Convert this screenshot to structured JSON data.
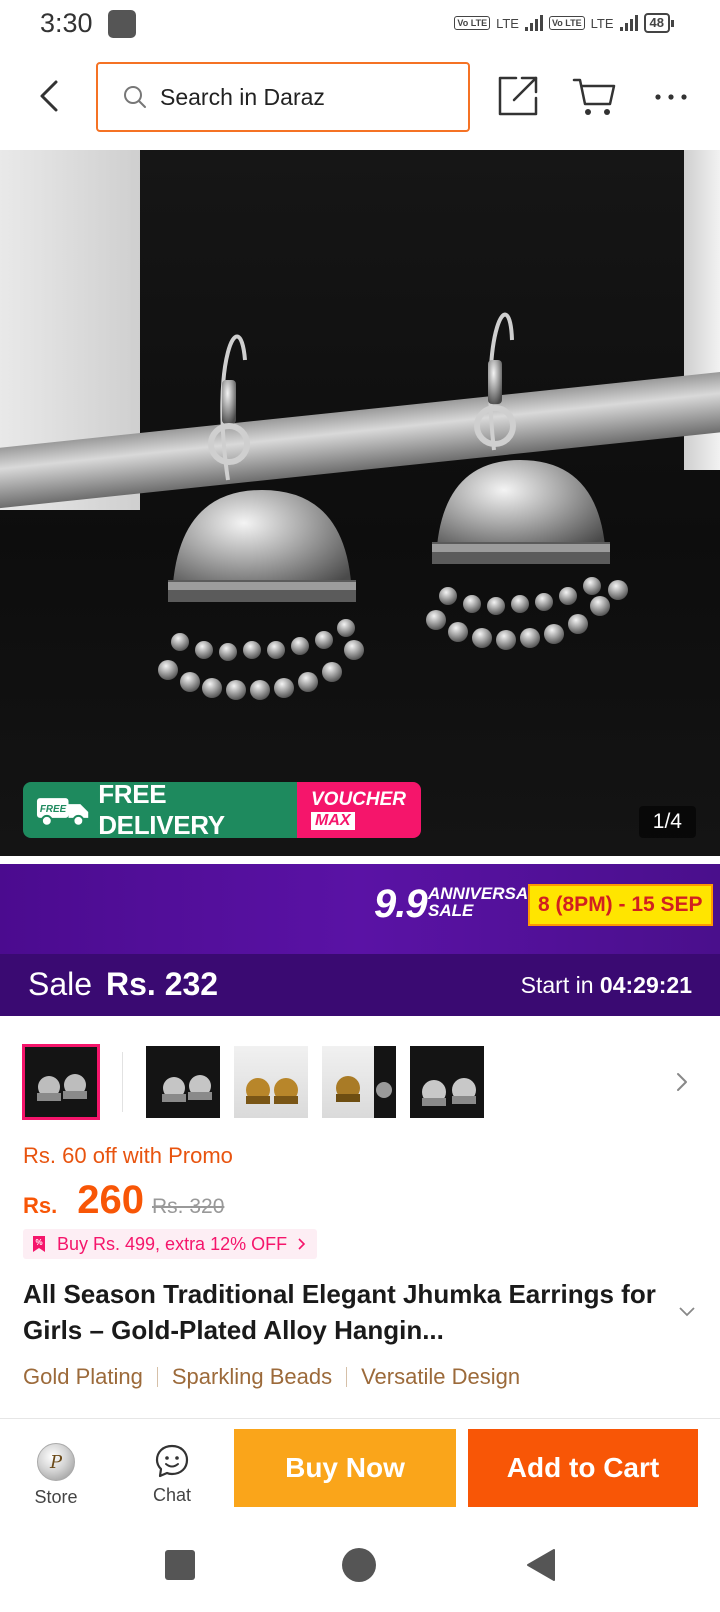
{
  "status_bar": {
    "time": "3:30",
    "network_1": "LTE",
    "network_2": "LTE",
    "volte_1": "Vo LTE",
    "volte_2": "Vo LTE",
    "battery": "48"
  },
  "header": {
    "back_icon": "chevron-left-icon",
    "search_placeholder": "Search in Daraz",
    "share_icon": "share-icon",
    "cart_icon": "cart-icon",
    "more_icon": "more-icon"
  },
  "gallery": {
    "free_delivery_label": "FREE DELIVERY",
    "free_tag": "FREE",
    "voucher_line1": "VOUCHER",
    "voucher_line2": "MAX",
    "counter": "1/4"
  },
  "sale_banner": {
    "event_number": "9.9",
    "event_word_1": "ANNIVERSARY",
    "event_word_2": "SALE",
    "event_dates": "8 (8PM) - 15 SEP",
    "sale_label": "Sale",
    "sale_price": "Rs. 232",
    "start_label": "Start in",
    "countdown": "04:29:21"
  },
  "thumbnails": {
    "count": 5,
    "selected_index": 0
  },
  "pricing": {
    "promo_text": "Rs. 60 off with Promo",
    "currency": "Rs.",
    "price": "260",
    "original_price": "Rs. 320",
    "extra_offer": "Buy Rs. 499, extra 12% OFF"
  },
  "product": {
    "title": "All Season Traditional Elegant Jhumka Earrings for Girls – Gold-Plated Alloy Hangin...",
    "tags": [
      "Gold Plating",
      "Sparkling Beads",
      "Versatile Design"
    ]
  },
  "bottom_bar": {
    "store_label": "Store",
    "chat_label": "Chat",
    "buy_now_label": "Buy Now",
    "add_to_cart_label": "Add to Cart"
  },
  "colors": {
    "brand_orange": "#f85606",
    "buy_now": "#faa51a",
    "sale_purple": "#3a0a72",
    "voucher_pink": "#f5156b",
    "free_delivery_green": "#1e8a5e"
  }
}
